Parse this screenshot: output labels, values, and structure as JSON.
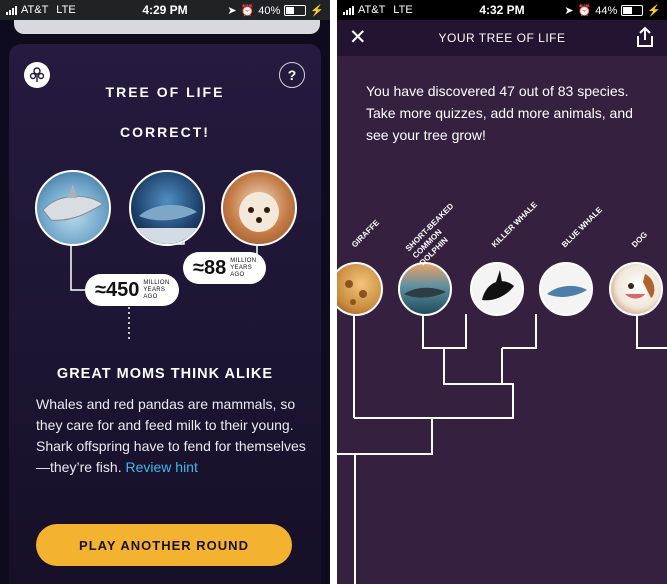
{
  "left_screen": {
    "status": {
      "carrier": "AT&T",
      "network": "LTE",
      "time": "4:29 PM",
      "battery": "40%"
    },
    "card": {
      "title": "TREE OF LIFE",
      "result": "CORRECT!",
      "help_label": "?",
      "divergences": [
        {
          "approx": "≈450",
          "unit_lines": [
            "MILLION",
            "YEARS",
            "AGO"
          ]
        },
        {
          "approx": "≈88",
          "unit_lines": [
            "MILLION",
            "YEARS",
            "AGO"
          ]
        }
      ],
      "headline": "GREAT MOMS THINK ALIKE",
      "body": "Whales and red pandas are mammals, so they care for and feed milk to their young. Shark offspring have to fend for themselves—they’re fish.",
      "hint_link": "Review hint",
      "play_button": "PLAY ANOTHER ROUND"
    }
  },
  "right_screen": {
    "status": {
      "carrier": "AT&T",
      "network": "LTE",
      "time": "4:32 PM",
      "battery": "44%"
    },
    "header_title": "YOUR TREE OF LIFE",
    "intro": "You have discovered 47 out of 83 species. Take more quizzes, add more animals, and see your tree grow!",
    "species": [
      {
        "label_lines": [
          "GIRAFFE"
        ]
      },
      {
        "label_lines": [
          "SHORT-BEAKED",
          "COMMON",
          "DOLPHIN"
        ]
      },
      {
        "label_lines": [
          "KILLER WHALE"
        ]
      },
      {
        "label_lines": [
          "BLUE WHALE"
        ]
      },
      {
        "label_lines": [
          "DOG"
        ]
      }
    ]
  },
  "colors": {
    "accent": "#f3b22f",
    "link": "#41b6e8",
    "card_bg": "#1d1533",
    "tree_bg": "#35213f"
  }
}
